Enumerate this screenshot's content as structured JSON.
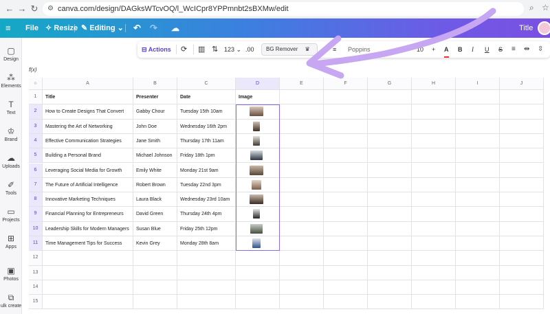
{
  "browser": {
    "url": "canva.com/design/DAGksWTcvOQ/l_WcICpr8YPPmnbt2sBXMw/edit"
  },
  "header": {
    "file_label": "File",
    "resize_label": "Resize",
    "editing_label": "Editing",
    "title_label": "Title"
  },
  "rail": {
    "items": [
      {
        "label": "Design",
        "icon": "design-icon"
      },
      {
        "label": "Elements",
        "icon": "elements-icon"
      },
      {
        "label": "Text",
        "icon": "text-icon"
      },
      {
        "label": "Brand",
        "icon": "brand-icon"
      },
      {
        "label": "Uploads",
        "icon": "uploads-icon"
      },
      {
        "label": "Tools",
        "icon": "tools-icon"
      },
      {
        "label": "Projects",
        "icon": "projects-icon"
      },
      {
        "label": "Apps",
        "icon": "apps-icon"
      },
      {
        "label": "Photos",
        "icon": "photos-icon"
      },
      {
        "label": "ulk create",
        "icon": "bulk-create-icon"
      }
    ]
  },
  "toolbar": {
    "actions_label": "Actions",
    "number_format": "123",
    "decimal": ".00",
    "bg_remover_label": "BG Remover",
    "font_name": "Poppins",
    "font_size": "10",
    "plus": "+",
    "bold": "B",
    "italic": "I",
    "underline": "U",
    "strike": "S"
  },
  "formula": {
    "fx": "f(x)"
  },
  "grid": {
    "column_letters": [
      "A",
      "B",
      "C",
      "D",
      "E",
      "F",
      "G",
      "H",
      "I",
      "J"
    ],
    "headers": {
      "title": "Title",
      "presenter": "Presenter",
      "date": "Date",
      "image": "Image"
    },
    "rows": [
      {
        "n": "2",
        "title": "How to Create Designs That Convert",
        "presenter": "Gabby Chour",
        "date": "Tuesday 15th 10am"
      },
      {
        "n": "3",
        "title": "Mastering the Art of Networking",
        "presenter": "John Doe",
        "date": "Wednesday 16th 2pm"
      },
      {
        "n": "4",
        "title": "Effective Communication Strategies",
        "presenter": "Jane Smith",
        "date": "Thursday 17th 11am"
      },
      {
        "n": "5",
        "title": "Building a Personal Brand",
        "presenter": "Michael Johnson",
        "date": "Friday 18th 1pm"
      },
      {
        "n": "6",
        "title": "Leveraging Social Media for Growth",
        "presenter": "Emily White",
        "date": "Monday 21st 9am"
      },
      {
        "n": "7",
        "title": "The Future of Artificial Intelligence",
        "presenter": "Robert Brown",
        "date": "Tuesday 22nd 3pm"
      },
      {
        "n": "8",
        "title": "Innovative Marketing Techniques",
        "presenter": "Laura Black",
        "date": "Wednesday 23rd 10am"
      },
      {
        "n": "9",
        "title": "Financial Planning for Entrepreneurs",
        "presenter": "David Green",
        "date": "Thursday 24th 4pm"
      },
      {
        "n": "10",
        "title": "Leadership Skills for Modern Managers",
        "presenter": "Susan Blue",
        "date": "Friday 25th 12pm"
      },
      {
        "n": "11",
        "title": "Time Management Tips for Success",
        "presenter": "Kevin Grey",
        "date": "Monday 28th 8am"
      }
    ],
    "empty_rows": [
      "12",
      "13",
      "14",
      "15"
    ]
  },
  "colors": {
    "accent": "#8b6be0",
    "annotation_arrow": "#c7a6f2"
  }
}
